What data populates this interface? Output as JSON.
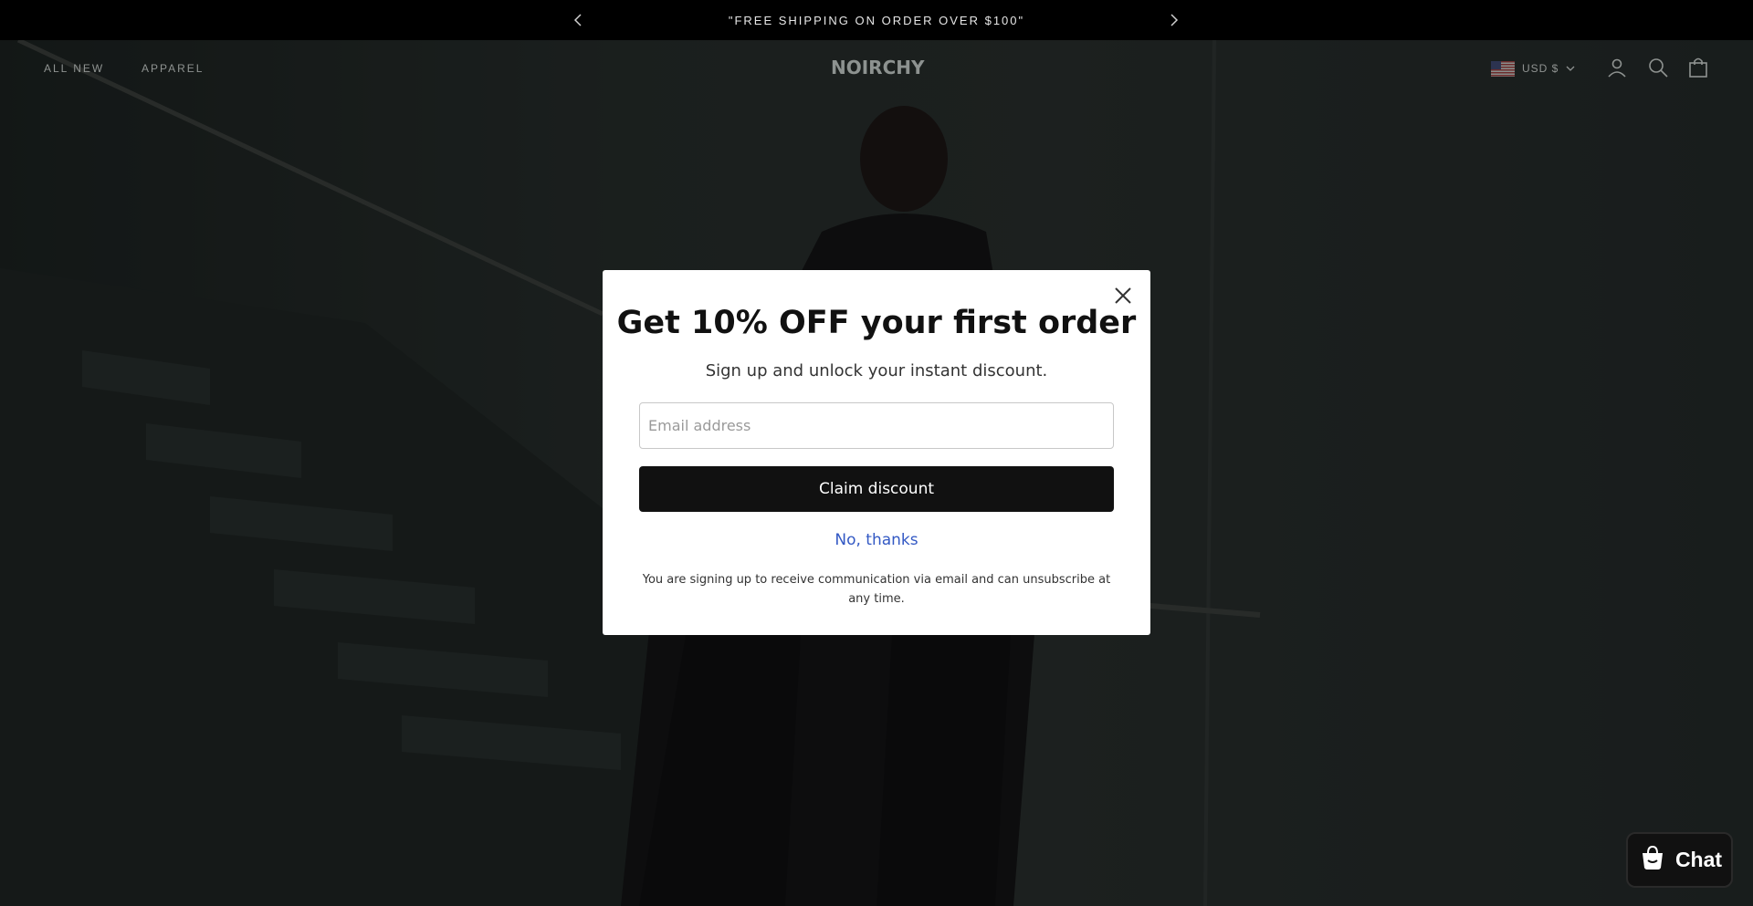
{
  "announcement": {
    "text": "\"FREE SHIPPING ON ORDER OVER $100\"",
    "prev_icon": "chevron-left-icon",
    "next_icon": "chevron-right-icon"
  },
  "header": {
    "nav": [
      {
        "label": "ALL NEW"
      },
      {
        "label": "APPAREL"
      }
    ],
    "logo": "NOIRCHY",
    "currency": {
      "label": "USD $",
      "flag": "us-flag-icon"
    },
    "icons": [
      "account-icon",
      "search-icon",
      "cart-icon"
    ]
  },
  "popup": {
    "title": "Get 10% OFF your first order",
    "subtitle": "Sign up and unlock your instant discount.",
    "email_placeholder": "Email address",
    "email_value": "",
    "claim_label": "Claim discount",
    "decline_label": "No, thanks",
    "legal": "You are signing up to receive communication via email and can unsubscribe at any time."
  },
  "chat": {
    "label": "Chat"
  },
  "colors": {
    "overlay": "#000000",
    "button": "#111111",
    "link": "#3359c4"
  }
}
